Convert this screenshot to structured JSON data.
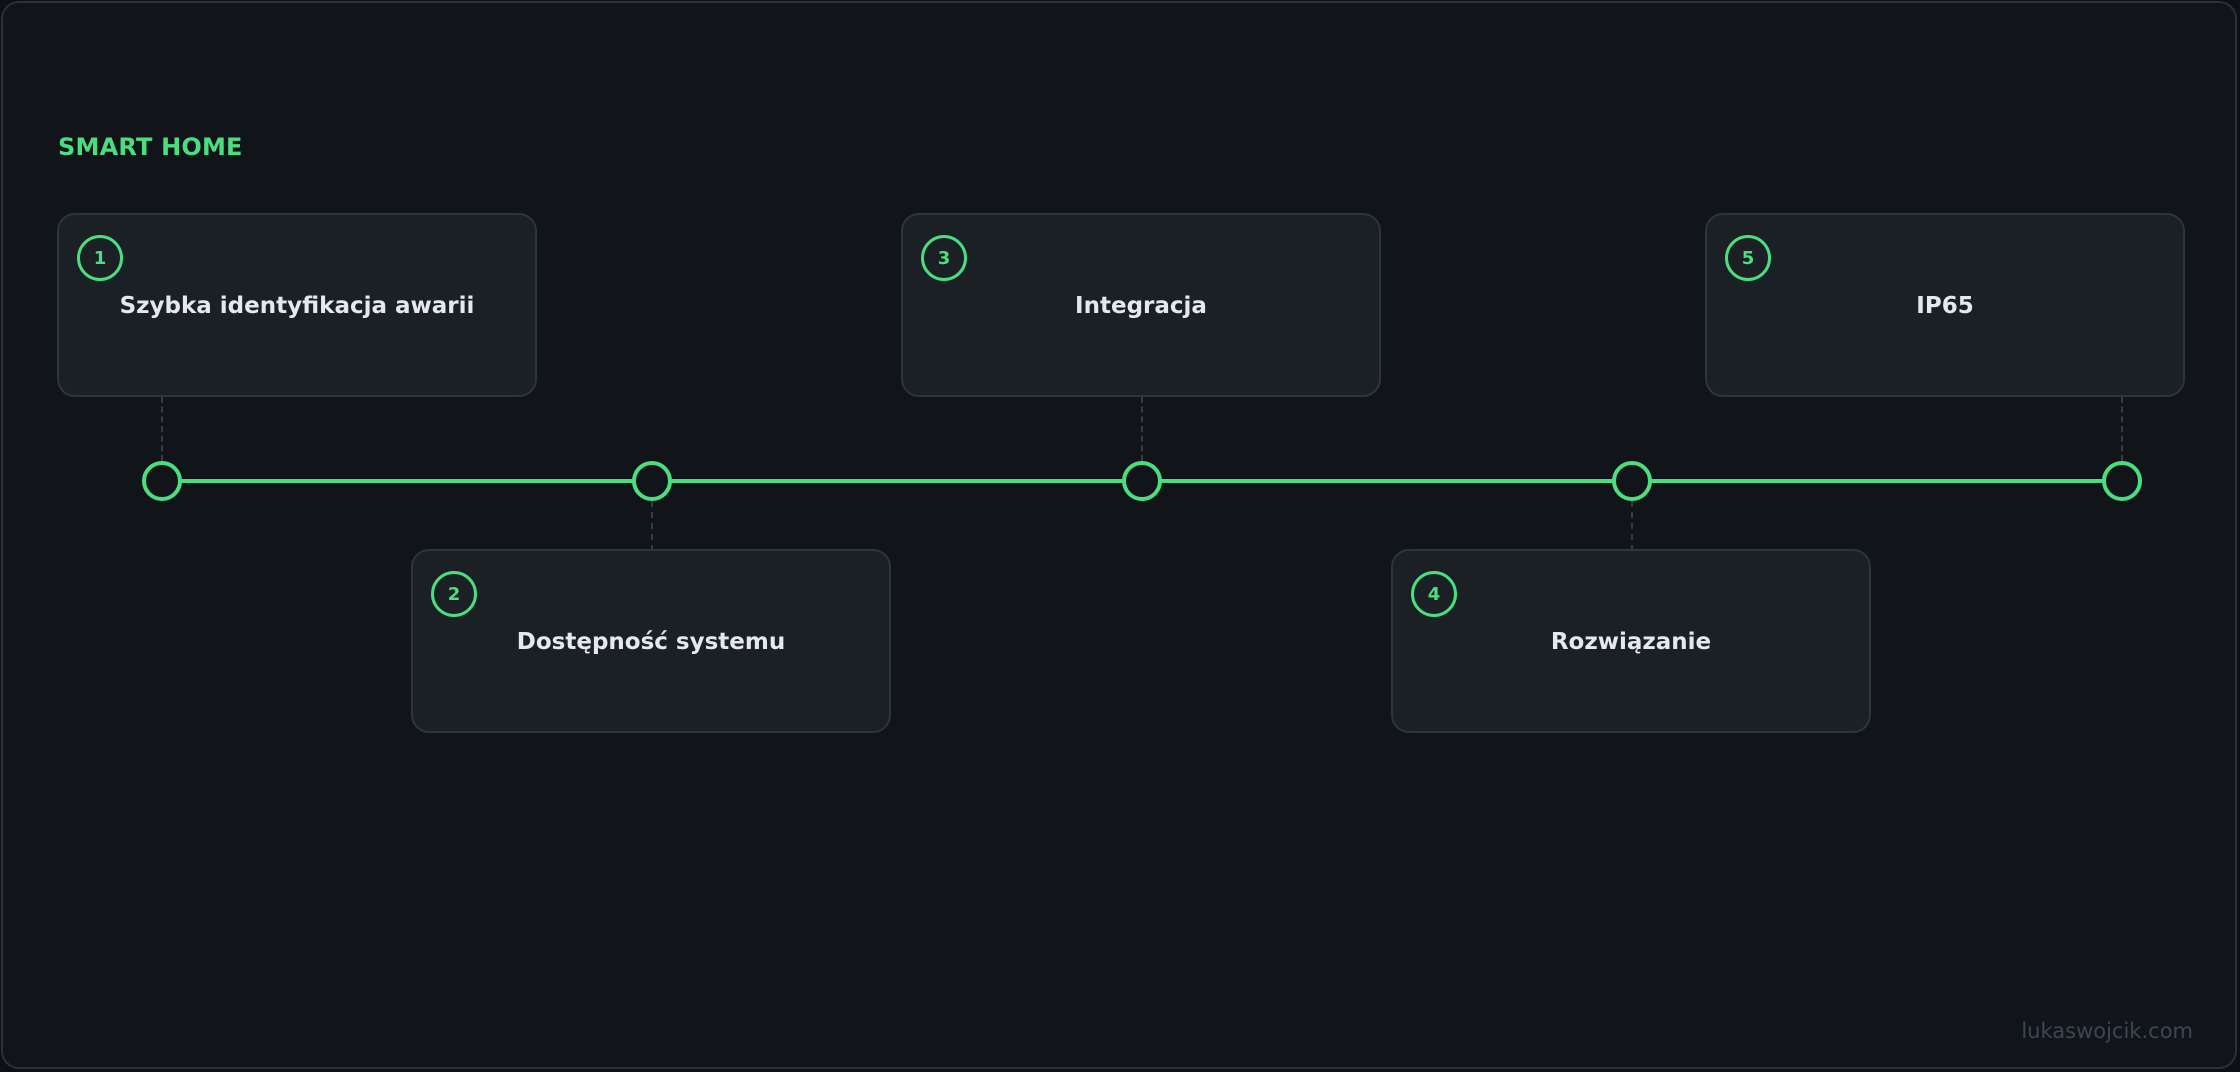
{
  "title": "SMART HOME",
  "steps": [
    {
      "number": "1",
      "label": "Szybka identyfikacja awarii"
    },
    {
      "number": "2",
      "label": "Dostępność systemu"
    },
    {
      "number": "3",
      "label": "Integracja"
    },
    {
      "number": "4",
      "label": "Rozwiązanie"
    },
    {
      "number": "5",
      "label": "IP65"
    }
  ],
  "watermark": "lukaswojcik.com",
  "colors": {
    "accent": "#4ade80",
    "background": "#11151a",
    "card": "#1b2025",
    "text": "#e5e9ee"
  }
}
